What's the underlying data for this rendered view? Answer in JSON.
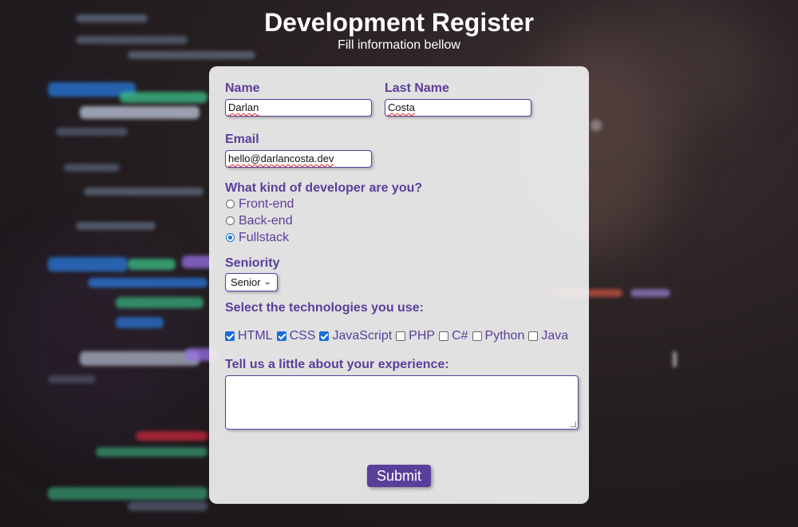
{
  "header": {
    "title": "Development Register",
    "subtitle": "Fill information bellow"
  },
  "form": {
    "name": {
      "label": "Name",
      "value": "Darlan"
    },
    "last_name": {
      "label": "Last Name",
      "value": "Costa"
    },
    "email": {
      "label": "Email",
      "value": "hello@darlancosta.dev"
    },
    "developer_type": {
      "label": "What kind of developer are you?",
      "options": [
        {
          "label": "Front-end",
          "checked": false
        },
        {
          "label": "Back-end",
          "checked": false
        },
        {
          "label": "Fullstack",
          "checked": true
        }
      ]
    },
    "seniority": {
      "label": "Seniority",
      "selected": "Senior"
    },
    "technologies": {
      "label": "Select the technologies you use:",
      "options": [
        {
          "label": "HTML",
          "checked": true
        },
        {
          "label": "CSS",
          "checked": true
        },
        {
          "label": "JavaScript",
          "checked": true
        },
        {
          "label": "PHP",
          "checked": false
        },
        {
          "label": "C#",
          "checked": false
        },
        {
          "label": "Python",
          "checked": false
        },
        {
          "label": "Java",
          "checked": false
        }
      ]
    },
    "experience": {
      "label": "Tell us a little about your experience:",
      "value": ""
    },
    "submit_label": "Submit"
  },
  "colors": {
    "accent": "#5a3f9a",
    "card_background": "#f0f0f0",
    "checked_blue": "#1a6fd8"
  }
}
